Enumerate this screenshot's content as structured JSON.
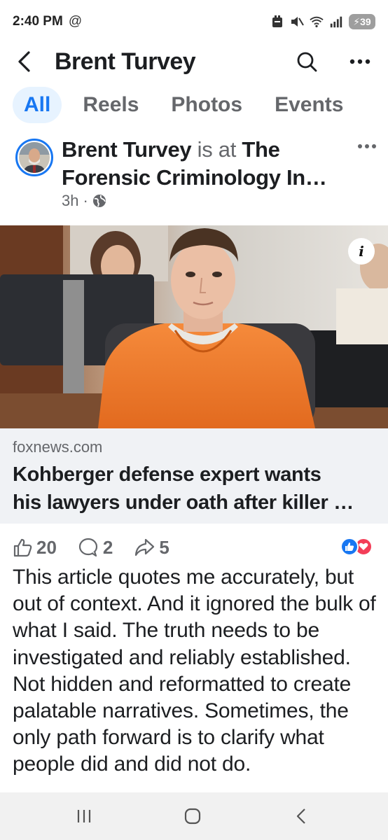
{
  "status_bar": {
    "time": "2:40 PM",
    "at_symbol": "@",
    "battery": "39",
    "signal_label": "5"
  },
  "header": {
    "title": "Brent Turvey"
  },
  "tabs": [
    {
      "label": "All",
      "active": true
    },
    {
      "label": "Reels",
      "active": false
    },
    {
      "label": "Photos",
      "active": false
    },
    {
      "label": "Events",
      "active": false
    }
  ],
  "post": {
    "author": "Brent Turvey",
    "connector": "is at",
    "place": "The Forensic Criminology In…",
    "time": "3h",
    "separator": "·",
    "audience_icon": "globe-icon",
    "link": {
      "domain": "foxnews.com",
      "headline_line1": "Kohberger defense expert wants",
      "headline_line2": "his lawyers under oath after killer …"
    },
    "stats": {
      "likes": "20",
      "comments": "2",
      "shares": "5"
    },
    "body": "This article quotes me accurately, but out of context. And it ignored the bulk of what I said. The truth needs to be investigated and reliably established. Not hidden and reformatted to create palatable narratives. Sometimes, the only path forward is to clarify what people did and did not do."
  },
  "colors": {
    "accent": "#1877f2",
    "tab_active_bg": "#e7f3ff",
    "muted": "#65676b",
    "link_bg": "#f0f2f5",
    "love": "#f33e58",
    "jumpsuit": "#f0782a"
  }
}
